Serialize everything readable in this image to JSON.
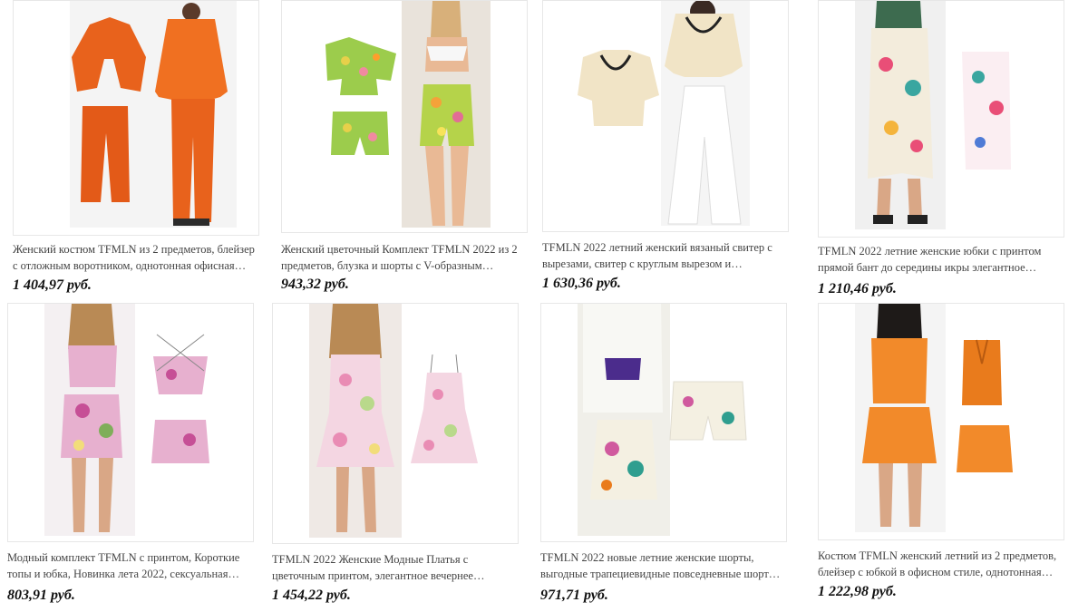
{
  "products": [
    {
      "title": "Женский костюм TFMLN из 2 предметов, блейзер с отложным воротником, однотонная офисная курт…",
      "price": "1 404,97 руб.",
      "palette": {
        "main": "#e8621c",
        "accent": "#d9531a"
      }
    },
    {
      "title": "Женский цветочный Комплект TFMLN 2022 из 2 предметов, блузка и шорты с V-образным вырезо…",
      "price": "943,32 руб.",
      "palette": {
        "main": "#9ccc4c",
        "accent": "#e7d04a"
      }
    },
    {
      "title": "TFMLN 2022 летний женский вязаный свитер с вырезами, свитер с круглым вырезом и коротким…",
      "price": "1 630,36 руб.",
      "palette": {
        "main": "#f1e4c6",
        "accent": "#ffffff"
      }
    },
    {
      "title": "TFMLN 2022 летние женские юбки с принтом прямой бант до середины икры элегантное…",
      "price": "1 210,46 руб.",
      "palette": {
        "main": "#f3ecdc",
        "accent": "#3d6b4f"
      }
    },
    {
      "title": "Модный комплект TFMLN с принтом, Короткие топы и юбка, Новинка лета 2022, сексуальная…",
      "price": "803,91 руб.",
      "palette": {
        "main": "#e7b0cf",
        "accent": "#c64f96"
      }
    },
    {
      "title": "TFMLN 2022 Женские Модные Платья с цветочным принтом, элегантное вечернее платье-…",
      "price": "1 454,22 руб.",
      "palette": {
        "main": "#f4d6e2",
        "accent": "#b9d98b"
      }
    },
    {
      "title": "TFMLN 2022 новые летние женские шорты, выгодные трапециевидные повседневные шорты …",
      "price": "971,71 руб.",
      "palette": {
        "main": "#f4f0e2",
        "accent": "#4b2c8c"
      }
    },
    {
      "title": "Костюм TFMLN женский летний из 2 предметов, блейзер с юбкой в офисном стиле, однотонная…",
      "price": "1 222,98 руб.",
      "palette": {
        "main": "#f28a2a",
        "accent": "#e97b1c"
      }
    }
  ]
}
